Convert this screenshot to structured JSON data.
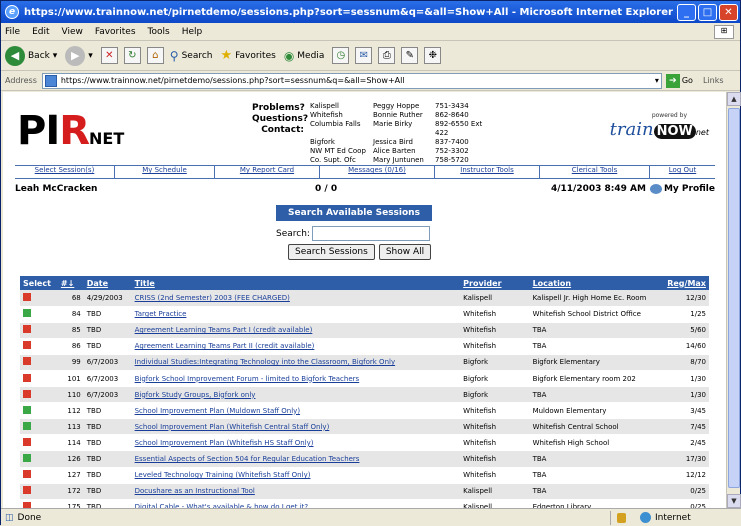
{
  "window": {
    "title": "https://www.trainnow.net/pirnetdemo/sessions.php?sort=sessnum&q=&all=Show+All - Microsoft Internet Explorer"
  },
  "menu": [
    "File",
    "Edit",
    "View",
    "Favorites",
    "Tools",
    "Help"
  ],
  "toolbar": {
    "back": "Back",
    "search": "Search",
    "favorites": "Favorites",
    "media": "Media"
  },
  "address": {
    "label": "Address",
    "url": "https://www.trainnow.net/pirnetdemo/sessions.php?sort=sessnum&q=&all=Show+All",
    "go": "Go",
    "links": "Links"
  },
  "status": {
    "text": "Done",
    "zone": "Internet"
  },
  "logo": {
    "pir": "PI",
    "r": "R",
    "net": "NET"
  },
  "problems": {
    "labels": [
      "Problems?",
      "Questions?",
      "Contact:"
    ]
  },
  "contacts": [
    [
      "Kalispell",
      "Peggy Hoppe",
      "751-3434"
    ],
    [
      "Whitefish",
      "Bonnie Ruther",
      "862-8640"
    ],
    [
      "Columbia Falls",
      "Marie Birky",
      "892-6550 Ext 422"
    ],
    [
      "Bigfork",
      "Jessica Bird",
      "837-7400"
    ],
    [
      "NW MT Ed Coop",
      "Alice Barten",
      "752-3302"
    ],
    [
      "Co. Supt. Ofc",
      "Mary Juntunen",
      "758-5720"
    ]
  ],
  "powered": {
    "by": "powered by",
    "brand": "train",
    "now": "NOW",
    "net": "net"
  },
  "nav": [
    "Select Session(s)",
    "My Schedule",
    "My Report Card",
    "Messages (0/16)",
    "Instructor Tools",
    "Clerical Tools",
    "Log Out"
  ],
  "user": {
    "name": "Leah McCracken",
    "messages": "0 / 0",
    "datetime": "4/11/2003 8:49 AM",
    "profile": "My Profile"
  },
  "search": {
    "header": "Search Available Sessions",
    "label": "Search:",
    "value": "",
    "search_button": "Search Sessions",
    "showall_button": "Show All"
  },
  "table": {
    "headers": [
      "Select",
      "#↓",
      "Date",
      "Title",
      "Provider",
      "Location",
      "Reg/Max"
    ],
    "rows": [
      {
        "dot": "#d93a2a",
        "num": "68",
        "date": "4/29/2003",
        "title": "CRISS (2nd Semester) 2003 (FEE CHARGED)",
        "provider": "Kalispell",
        "location": "Kalispell Jr. High Home Ec. Room",
        "regmax": "12/30"
      },
      {
        "dot": "#3aa845",
        "num": "84",
        "date": "TBD",
        "title": "Target Practice",
        "provider": "Whitefish",
        "location": "Whitefish School District Office",
        "regmax": "1/25"
      },
      {
        "dot": "#d93a2a",
        "num": "85",
        "date": "TBD",
        "title": "Agreement Learning Teams Part I (credit available)",
        "provider": "Whitefish",
        "location": "TBA",
        "regmax": "5/60"
      },
      {
        "dot": "#d93a2a",
        "num": "86",
        "date": "TBD",
        "title": "Agreement Learning Teams Part II (credit available)",
        "provider": "Whitefish",
        "location": "TBA",
        "regmax": "14/60"
      },
      {
        "dot": "#d93a2a",
        "num": "99",
        "date": "6/7/2003",
        "title": "Individual Studies:Integrating Technology into the Classroom, Bigfork Only",
        "provider": "Bigfork",
        "location": "Bigfork Elementary",
        "regmax": "8/70"
      },
      {
        "dot": "#d93a2a",
        "num": "101",
        "date": "6/7/2003",
        "title": "Bigfork School Improvement Forum - limited to Bigfork Teachers",
        "provider": "Bigfork",
        "location": "Bigfork Elementary room 202",
        "regmax": "1/30"
      },
      {
        "dot": "#d93a2a",
        "num": "110",
        "date": "6/7/2003",
        "title": "Bigfork Study Groups, Bigfork only",
        "provider": "Bigfork",
        "location": "TBA",
        "regmax": "1/30"
      },
      {
        "dot": "#3aa845",
        "num": "112",
        "date": "TBD",
        "title": "School Improvement Plan (Muldown Staff Only)",
        "provider": "Whitefish",
        "location": "Muldown Elementary",
        "regmax": "3/45"
      },
      {
        "dot": "#3aa845",
        "num": "113",
        "date": "TBD",
        "title": "School Improvement Plan (Whitefish Central Staff Only)",
        "provider": "Whitefish",
        "location": "Whitefish Central School",
        "regmax": "7/45"
      },
      {
        "dot": "#d93a2a",
        "num": "114",
        "date": "TBD",
        "title": "School Improvement Plan (Whitefish HS Staff Only)",
        "provider": "Whitefish",
        "location": "Whitefish High School",
        "regmax": "2/45"
      },
      {
        "dot": "#3aa845",
        "num": "126",
        "date": "TBD",
        "title": "Essential Aspects of Section 504 for Regular Education Teachers",
        "provider": "Whitefish",
        "location": "TBA",
        "regmax": "17/30"
      },
      {
        "dot": "#d93a2a",
        "num": "127",
        "date": "TBD",
        "title": "Leveled Technology Training (Whitefish Staff Only)",
        "provider": "Whitefish",
        "location": "TBA",
        "regmax": "12/12"
      },
      {
        "dot": "#d93a2a",
        "num": "172",
        "date": "TBD",
        "title": "Docushare as an Instructional Tool",
        "provider": "Kalispell",
        "location": "TBA",
        "regmax": "0/25"
      },
      {
        "dot": "#d93a2a",
        "num": "175",
        "date": "TBD",
        "title": "Digital Cable - What's available & how do I get it?",
        "provider": "Kalispell",
        "location": "Edgerton Library",
        "regmax": "0/25"
      }
    ]
  }
}
